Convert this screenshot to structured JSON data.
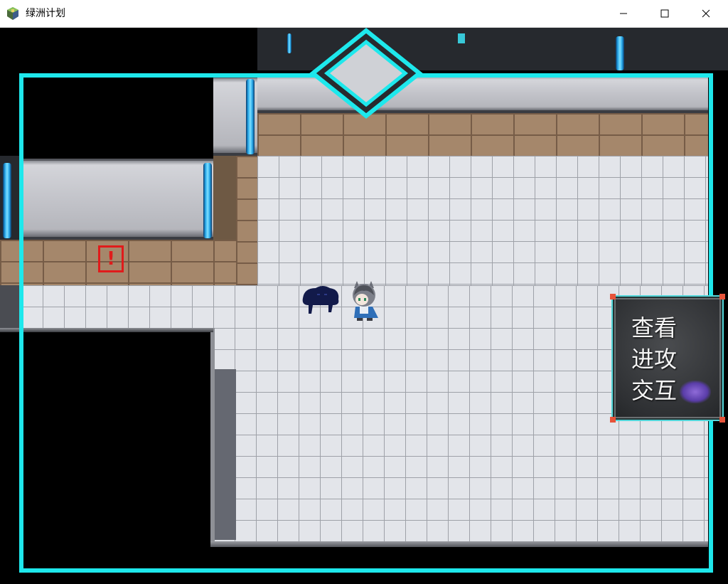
{
  "window": {
    "title": "绿洲计划",
    "icons": {
      "app": "game-app-icon",
      "minimize": "minimize-icon",
      "maximize": "maximize-icon",
      "close": "close-icon"
    }
  },
  "scene": {
    "alert_marker": "!",
    "characters": [
      "shadow-creature",
      "wolf-girl-player"
    ]
  },
  "command_menu": {
    "items": [
      {
        "label": "查看"
      },
      {
        "label": "进攻"
      },
      {
        "label": "交互"
      }
    ],
    "selected_index": 2
  },
  "colors": {
    "frame": "#1ee8ec",
    "floor": "#e3e5ea",
    "alert": "#e01b1b",
    "menu_border": "#53d6d9",
    "selection": "#7b5bd0"
  }
}
